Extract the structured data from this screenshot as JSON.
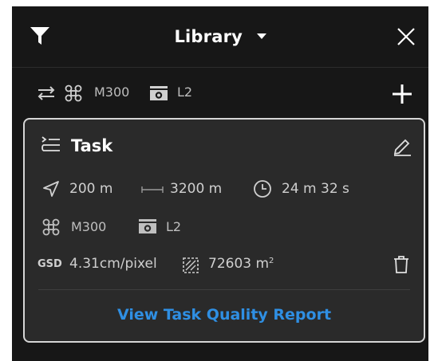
{
  "header": {
    "title": "Library",
    "filter_icon": "filter-icon",
    "dropdown_icon": "caret-down-icon",
    "close_icon": "close-icon"
  },
  "subbar": {
    "drone": "M300",
    "payload": "L2",
    "add_icon": "plus-icon"
  },
  "task_card": {
    "name": "Task",
    "altitude": "200 m",
    "distance": "3200 m",
    "duration": "24 m 32 s",
    "drone": "M300",
    "payload": "L2",
    "gsd_label": "GSD",
    "gsd_value": "4.31cm/pixel",
    "area": "72603 m",
    "area_unit_sup": "2",
    "report_link": "View Task Quality Report"
  },
  "colors": {
    "background": "#171717",
    "card": "#2a2a2a",
    "link": "#2f8fe3",
    "text": "#ffffff"
  }
}
